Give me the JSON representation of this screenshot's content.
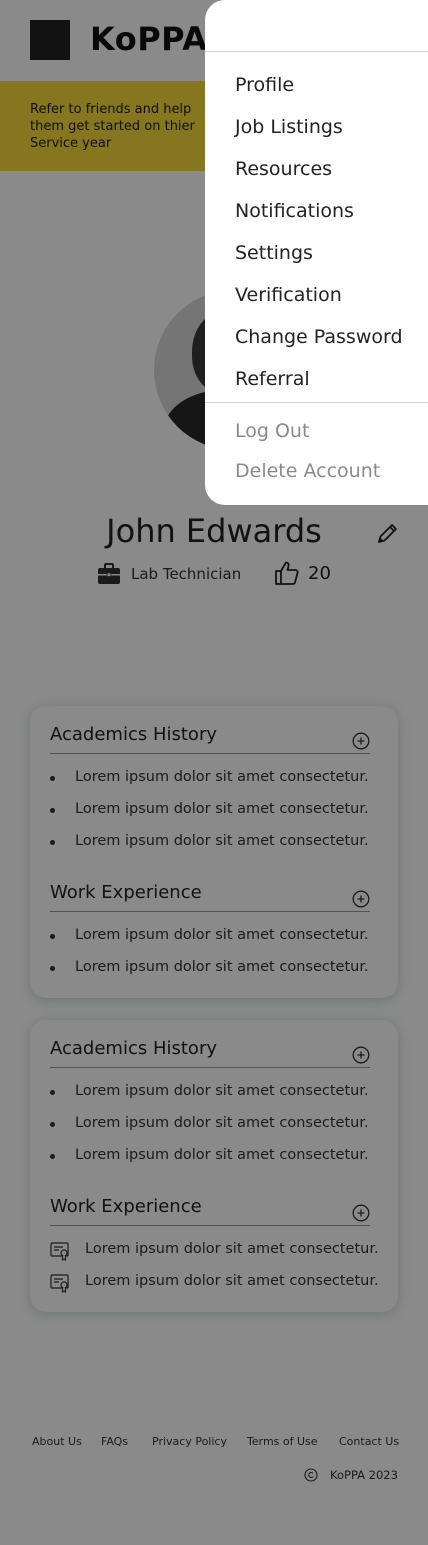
{
  "header": {
    "brand": "KoPPA"
  },
  "banner": {
    "text": "Refer to friends and help them get started on thier Service year"
  },
  "profile": {
    "name": "John Edwards",
    "role": "Lab Technician",
    "likes": "20"
  },
  "cards": [
    {
      "academics_title": "Academics History",
      "academics_items": [
        "Lorem ipsum dolor sit amet consectetur.",
        "Lorem ipsum dolor sit amet consectetur.",
        "Lorem ipsum dolor sit amet consectetur."
      ],
      "work_title": "Work Experience",
      "work_items": [
        "Lorem ipsum dolor sit amet consectetur.",
        "Lorem ipsum dolor sit amet consectetur."
      ]
    },
    {
      "academics_title": "Academics History",
      "academics_items": [
        "Lorem ipsum dolor sit amet consectetur.",
        "Lorem ipsum dolor sit amet consectetur.",
        "Lorem ipsum dolor sit amet consectetur."
      ],
      "work_title": "Work Experience",
      "work_items": [
        "Lorem ipsum dolor sit amet consectetur.",
        "Lorem ipsum dolor sit amet consectetur."
      ]
    }
  ],
  "footer": {
    "links": [
      "About Us",
      "FAQs",
      "Privacy Policy",
      "Terms of Use",
      "Contact Us"
    ],
    "copyright": "KoPPA 2023"
  },
  "menu": {
    "items": [
      "Profile",
      "Job Listings",
      "Resources",
      "Notifications",
      "Settings",
      "Verification",
      "Change Password",
      "Referral"
    ],
    "secondary": [
      "Log Out",
      "Delete Account"
    ]
  },
  "colors": {
    "banner": "#f5da3a",
    "card_shadow": "#78aaa5",
    "overlay": "#000000"
  },
  "icons": [
    "edit-icon",
    "briefcase-icon",
    "thumbs-up-icon",
    "add-circle-icon",
    "certificate-icon",
    "copyright-icon"
  ]
}
